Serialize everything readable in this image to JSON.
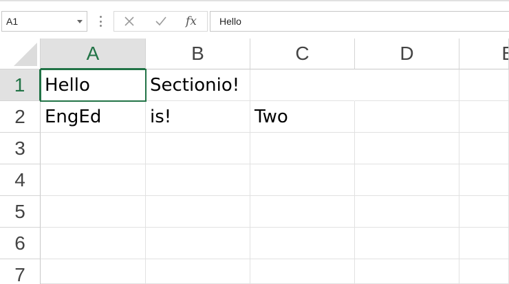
{
  "name_box": {
    "value": "A1"
  },
  "formula_bar": {
    "cancel_icon": "close-icon",
    "enter_icon": "checkmark-icon",
    "fx_label": "fx",
    "value": "Hello"
  },
  "columns": [
    {
      "label": "A"
    },
    {
      "label": "B"
    },
    {
      "label": "C"
    },
    {
      "label": "D"
    },
    {
      "label": "E"
    }
  ],
  "rows": [
    {
      "label": "1"
    },
    {
      "label": "2"
    },
    {
      "label": "3"
    },
    {
      "label": "4"
    },
    {
      "label": "5"
    },
    {
      "label": "6"
    },
    {
      "label": "7"
    }
  ],
  "cells": {
    "A1": "Hello",
    "B1": "Sectionio!",
    "A2": "EngEd",
    "B2": "is!",
    "C2": "Two"
  },
  "selection": {
    "active_cell": "A1",
    "accent_color": "#217346"
  }
}
